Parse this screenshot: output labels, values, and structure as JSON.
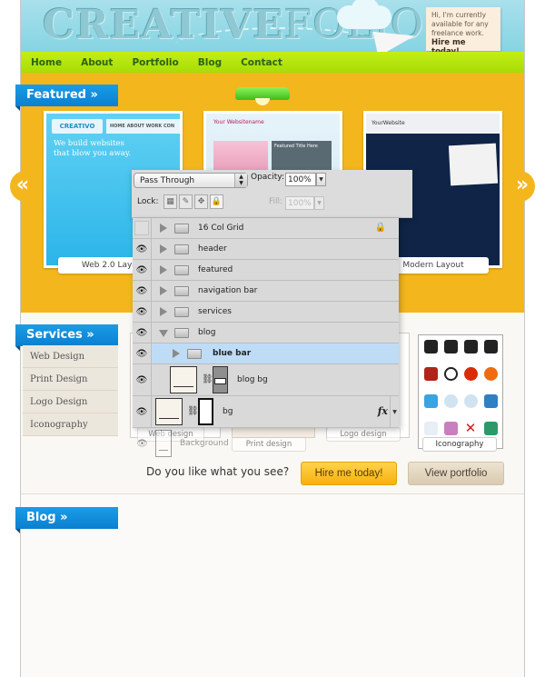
{
  "header": {
    "logo_bold": "CREATIVE",
    "logo_light": "FOLIO",
    "note_lines": [
      "Hi, I'm currently",
      "available for any",
      "freelance work."
    ],
    "note_cta": "Hire me today!"
  },
  "nav": {
    "items": [
      "Home",
      "About",
      "Portfolio",
      "Blog",
      "Contact"
    ]
  },
  "featured": {
    "heading": "Featured »",
    "prev_icon": "«",
    "next_icon": "»",
    "items": [
      {
        "caption": "Web 2.0 Layout",
        "brand": "CREATIVO",
        "menu": "HOME  ABOUT  WORK  CON",
        "headline": "We build websites that blow you away."
      },
      {
        "caption": "",
        "brand": "Your Websitename",
        "feature_title": "Featured Title Here"
      },
      {
        "caption": "Modern Layout",
        "brand": "YourWebsite"
      }
    ]
  },
  "services": {
    "heading": "Services »",
    "items": [
      "Web Design",
      "Print Design",
      "Logo Design",
      "Iconography"
    ],
    "thumb_captions": [
      "Web design",
      "Print design",
      "Logo design",
      "Iconography"
    ],
    "cta_question": "Do you like what you see?",
    "hire_button": "Hire me today!",
    "portfolio_button": "View portfolio"
  },
  "layers_panel": {
    "blend_mode": "Pass Through",
    "opacity_label": "Opacity:",
    "opacity_value": "100%",
    "lock_label": "Lock:",
    "fill_label": "Fill:",
    "fill_value": "100%",
    "layers": [
      {
        "name": "16 Col Grid",
        "type": "group",
        "visible": false,
        "locked": true,
        "expanded": false
      },
      {
        "name": "header",
        "type": "group",
        "visible": true,
        "expanded": false
      },
      {
        "name": "featured",
        "type": "group",
        "visible": true,
        "expanded": false
      },
      {
        "name": "navigation bar",
        "type": "group",
        "visible": true,
        "expanded": false
      },
      {
        "name": "services",
        "type": "group",
        "visible": true,
        "expanded": false
      },
      {
        "name": "blog",
        "type": "group",
        "visible": true,
        "expanded": true
      },
      {
        "name": "blue bar",
        "type": "group",
        "visible": true,
        "expanded": false,
        "selected": true
      },
      {
        "name": "blog bg",
        "type": "layer-with-mask",
        "visible": true
      },
      {
        "name": "bg",
        "type": "layer-with-mask",
        "visible": true,
        "has_fx": true
      },
      {
        "name": "Background",
        "type": "layer",
        "visible": true
      }
    ],
    "fx_label": "fx"
  },
  "blog": {
    "heading": "Blog »"
  },
  "colors": {
    "featured_bg": "#f4b61d",
    "nav_green": "#b5e60e",
    "ribbon_blue": "#0a8ad8",
    "header_sky": "#93d8e6",
    "selected_layer": "#bfdcf7"
  }
}
